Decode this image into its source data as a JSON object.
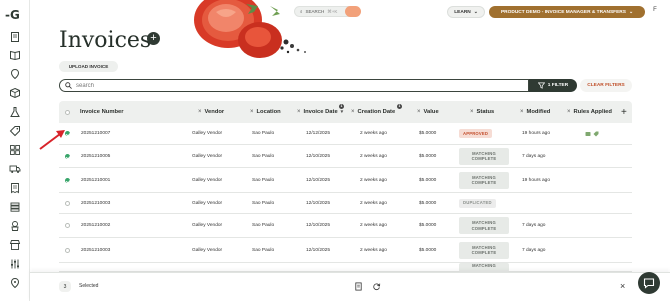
{
  "app": {
    "logo_text": "-G"
  },
  "topbar": {
    "search_label": "SEARCH",
    "search_shortcut": "⌘+K",
    "learn_label": "LEARN",
    "demo_label": "PRODUCT DEMO - INVOICE MANAGER & TRANSFERS",
    "user_initial": "F"
  },
  "page": {
    "title": "Invoices",
    "add_symbol": "+",
    "upload_label": "UPLOAD INVOICE"
  },
  "filters": {
    "search_placeholder": "search",
    "filter_label": "1 FILTER",
    "clear_label": "CLEAR FILTERS"
  },
  "columns": {
    "invoice_number": "Invoice Number",
    "vendor": "Vendor",
    "location": "Location",
    "invoice_date": "Invoice Date",
    "creation_date": "Creation Date",
    "value": "Value",
    "status": "Status",
    "modified": "Modified",
    "rules_applied": "Rules Applied",
    "add_column": "+",
    "remove_symbol": "×",
    "badge_count": "1"
  },
  "rows": [
    {
      "invoice": "20251210007",
      "vendor": "Galley Vendor",
      "location": "Sao Paulo",
      "invoice_date": "12/12/2025",
      "creation_date": "2 weeks ago",
      "value": "$5.0000",
      "status": "APPROVED",
      "modified": "19 hours ago",
      "checked": true,
      "rules": true
    },
    {
      "invoice": "20251210005",
      "vendor": "Galley Vendor",
      "location": "Sao Paulo",
      "invoice_date": "12/10/2025",
      "creation_date": "2 weeks ago",
      "value": "$5.0000",
      "status": "MATCHING COMPLETE",
      "modified": "7 days ago",
      "checked": true,
      "rules": false
    },
    {
      "invoice": "20251210001",
      "vendor": "Galley Vendor",
      "location": "Sao Paulo",
      "invoice_date": "12/10/2025",
      "creation_date": "2 weeks ago",
      "value": "$5.0000",
      "status": "MATCHING COMPLETE",
      "modified": "19 hours ago",
      "checked": true,
      "rules": false
    },
    {
      "invoice": "20251210003",
      "vendor": "Galley Vendor",
      "location": "Sao Paulo",
      "invoice_date": "12/10/2025",
      "creation_date": "2 weeks ago",
      "value": "$5.0000",
      "status": "DUPLICATED",
      "modified": "",
      "checked": false,
      "rules": false
    },
    {
      "invoice": "20251210002",
      "vendor": "Galley Vendor",
      "location": "Sao Paulo",
      "invoice_date": "12/10/2025",
      "creation_date": "2 weeks ago",
      "value": "$5.0000",
      "status": "MATCHING COMPLETE",
      "modified": "7 days ago",
      "checked": false,
      "rules": false
    },
    {
      "invoice": "20251210003",
      "vendor": "Galley Vendor",
      "location": "Sao Paulo",
      "invoice_date": "12/10/2025",
      "creation_date": "2 weeks ago",
      "value": "$5.0000",
      "status": "MATCHING COMPLETE",
      "modified": "7 days ago",
      "checked": false,
      "rules": false
    },
    {
      "invoice": "",
      "vendor": "",
      "location": "",
      "invoice_date": "",
      "creation_date": "",
      "value": "",
      "status": "MATCHING",
      "modified": "",
      "checked": false,
      "rules": false
    }
  ],
  "footer": {
    "selected_count": "3",
    "selected_label": "Selected",
    "close_symbol": "×"
  },
  "colors": {
    "brand_dark": "#2f3a33",
    "accent_gold": "#a0702f",
    "approved_red": "#c24d2b",
    "annotation_red": "#d8232a",
    "check_green": "#38a56a"
  },
  "icons": {
    "sidebar": [
      "document-icon",
      "book-icon",
      "location-pin-icon",
      "box-icon",
      "flask-icon",
      "tag-icon",
      "grid-icon",
      "truck-icon",
      "receipt-icon",
      "stack-icon",
      "chef-icon",
      "store-icon",
      "sliders-icon",
      "settings-icon",
      "map-pin-icon"
    ]
  }
}
